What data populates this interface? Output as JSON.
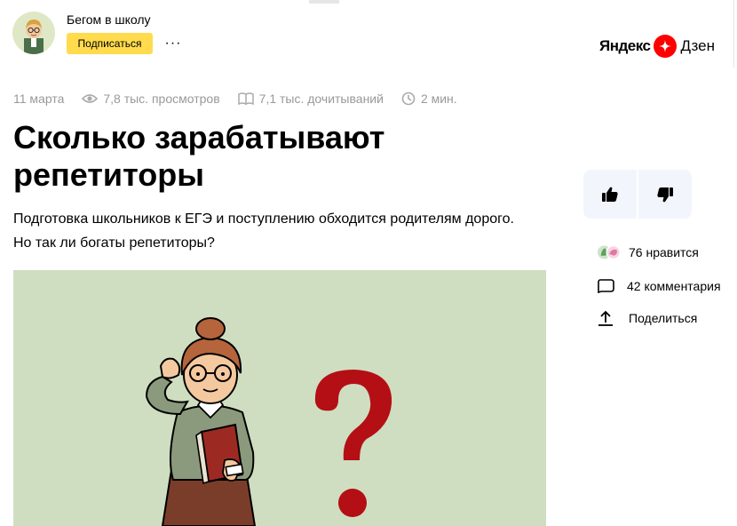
{
  "channel": {
    "name": "Бегом в школу",
    "subscribe_label": "Подписаться",
    "more_label": "···"
  },
  "brand": {
    "yandex": "Яндекс",
    "zen": "Дзен",
    "accent": "#ff0000"
  },
  "meta": {
    "date": "11 марта",
    "views": "7,8 тыс. просмотров",
    "reads": "7,1 тыс. дочитываний",
    "read_time": "2 мин."
  },
  "article": {
    "title": "Сколько зарабатывают репетиторы",
    "lead": "Подготовка школьников к ЕГЭ и поступлению обходится родителям дорого. Но так ли богаты репетиторы?"
  },
  "sidebar": {
    "likes": "76 нравится",
    "comments": "42 комментария",
    "share": "Поделиться"
  },
  "icons": {
    "views": "eye-icon",
    "reads": "book-icon",
    "time": "clock-icon",
    "like": "thumbs-up-icon",
    "dislike": "thumbs-down-icon",
    "comment": "comment-icon",
    "share": "share-icon"
  },
  "colors": {
    "subscribe": "#ffdb4d",
    "reaction_bg": "#f2f6fc",
    "hero_bg": "#cfdec0",
    "question_mark": "#b30f15"
  }
}
